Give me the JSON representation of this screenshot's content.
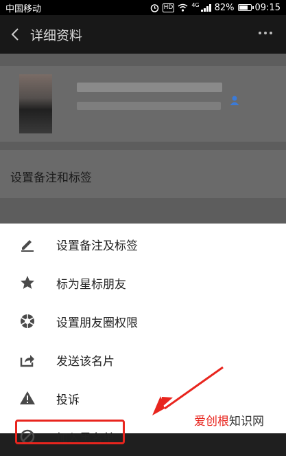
{
  "status_bar": {
    "carrier": "中国移动",
    "hd": "HD",
    "network": "4G",
    "battery": "82%",
    "battery_level": 0.82,
    "time": "09:15"
  },
  "title_bar": {
    "title": "详细资料"
  },
  "profile": {
    "remark_row_label": "设置备注和标签"
  },
  "menu": {
    "items": [
      {
        "label": "设置备注及标签",
        "icon": "pencil-icon"
      },
      {
        "label": "标为星标朋友",
        "icon": "star-icon"
      },
      {
        "label": "设置朋友圈权限",
        "icon": "aperture-icon"
      },
      {
        "label": "发送该名片",
        "icon": "share-icon"
      },
      {
        "label": "投诉",
        "icon": "warning-icon"
      },
      {
        "label": "加入黑名单",
        "icon": "block-icon"
      }
    ]
  },
  "watermark": {
    "accent": "爱创根",
    "rest": "知识网"
  },
  "colors": {
    "annotation_red": "#e8251e",
    "sheet_bg": "#ffffff",
    "titlebar_bg": "#181818"
  }
}
